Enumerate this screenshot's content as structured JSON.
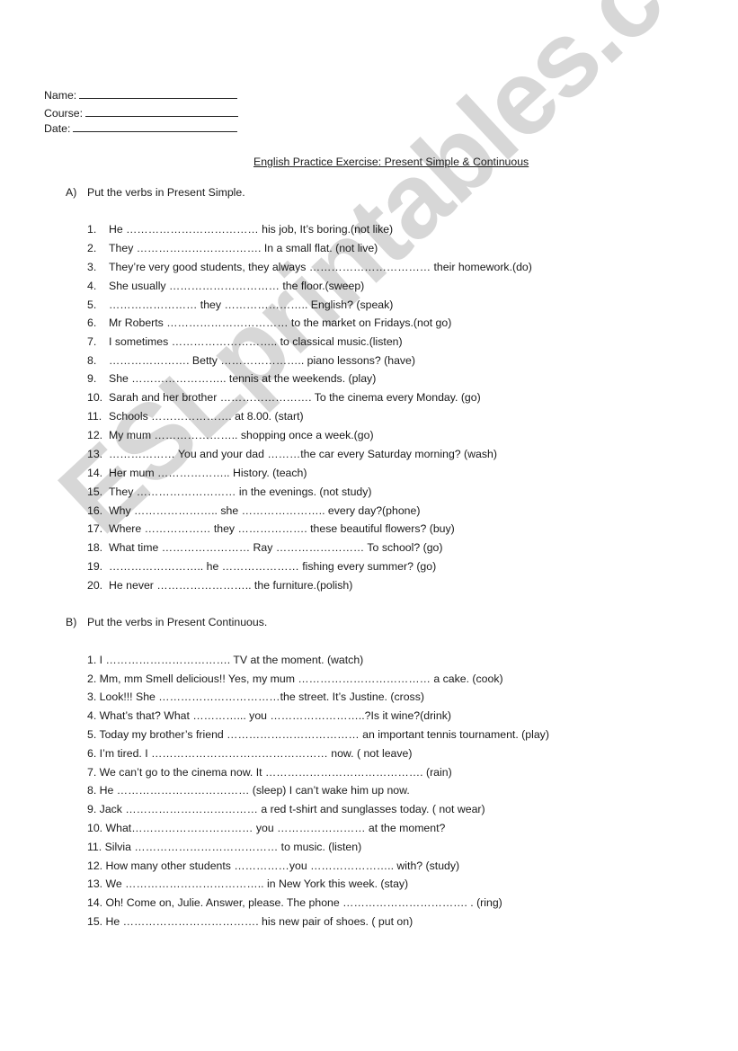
{
  "header": {
    "name_label": "Name:",
    "course_label": "Course:",
    "date_label": "Date:"
  },
  "title": "English Practice Exercise: Present Simple & Continuous",
  "section_a": {
    "letter": "A)",
    "instruction": "Put the verbs in Present Simple.",
    "items": [
      {
        "num": "1.",
        "text": "He ……………………………… his job, It’s boring.(not like)"
      },
      {
        "num": "2.",
        "text": "They ……………………………. In a small flat. (not live)"
      },
      {
        "num": "3.",
        "text": "They’re very good students, they always …………………………… their homework.(do)"
      },
      {
        "num": "4.",
        "text": "She usually ………………………… the floor.(sweep)"
      },
      {
        "num": "5.",
        "text": "…………………… they ………………….. English? (speak)"
      },
      {
        "num": "6.",
        "text": "Mr Roberts …………………………… to the market on Fridays.(not go)"
      },
      {
        "num": "7.",
        "text": " I sometimes ……………………….. to classical music.(listen)"
      },
      {
        "num": "8.",
        "text": "…………………. Betty ………………….. piano lessons? (have)"
      },
      {
        "num": "9.",
        "text": "She …………………….. tennis at the weekends. (play)"
      },
      {
        "num": "10.",
        "text": "Sarah and her brother ……………………. To the cinema every Monday. (go)"
      },
      {
        "num": "11.",
        "text": "Schools …………………. at 8.00. (start)"
      },
      {
        "num": "12.",
        "text": "My mum ………………….. shopping once a week.(go)"
      },
      {
        "num": "13.",
        "text": "……………… You and your dad ………the car every Saturday morning? (wash)"
      },
      {
        "num": "14.",
        "text": "Her mum ……………….. History. (teach)"
      },
      {
        "num": "15.",
        "text": "They ……………………… in the evenings. (not study)"
      },
      {
        "num": "16.",
        "text": "Why ………………….. she ………………….. every day?(phone)"
      },
      {
        "num": "17.",
        "text": "Where ……………… they ………………. these beautiful flowers? (buy)"
      },
      {
        "num": "18.",
        "text": "What time …………………… Ray …………………… To school? (go)"
      },
      {
        "num": "19.",
        "text": "…………………….. he ………………… fishing every summer? (go)"
      },
      {
        "num": "20.",
        "text": "He never …………………….. the furniture.(polish)"
      }
    ]
  },
  "section_b": {
    "letter": "B)",
    "instruction": "Put the verbs in Present Continuous.",
    "items": [
      {
        "text": "1. I ……………………………. TV at the moment. (watch)"
      },
      {
        "text": "2. Mm, mm Smell delicious!! Yes, my mum ……………………………… a cake. (cook)"
      },
      {
        "text": "3. Look!!! She ……………………………the street. It’s Justine. (cross)"
      },
      {
        "text": "4. What’s that? What …………... you ……………………..?Is it wine?(drink)"
      },
      {
        "text": "5. Today my brother’s friend ……………………………… an important tennis tournament. (play)"
      },
      {
        "text": "6. I’m tired. I ………………………………………… now. ( not leave)"
      },
      {
        "text": "7. We can’t go to the cinema now. It ……………………………………. (rain)"
      },
      {
        "text": "8. He ……………………………… (sleep) I can’t wake him up now."
      },
      {
        "text": "9. Jack ……………………………… a red t-shirt and sunglasses today. ( not wear)"
      },
      {
        "text": "10. What…………………………… you …………………… at the moment?"
      },
      {
        "text": "11. Silvia ………………………………… to music. (listen)"
      },
      {
        "text": "12. How many other students ……………you ………………….. with? (study)"
      },
      {
        "text": "13. We ……………………………….. in New York this week. (stay)"
      },
      {
        "text": "14. Oh! Come on, Julie. Answer, please. The phone ……………………………. . (ring)"
      },
      {
        "text": "15. He ………………………………. his new pair of shoes. ( put on)"
      }
    ]
  },
  "watermark": "ESLprintables.com"
}
